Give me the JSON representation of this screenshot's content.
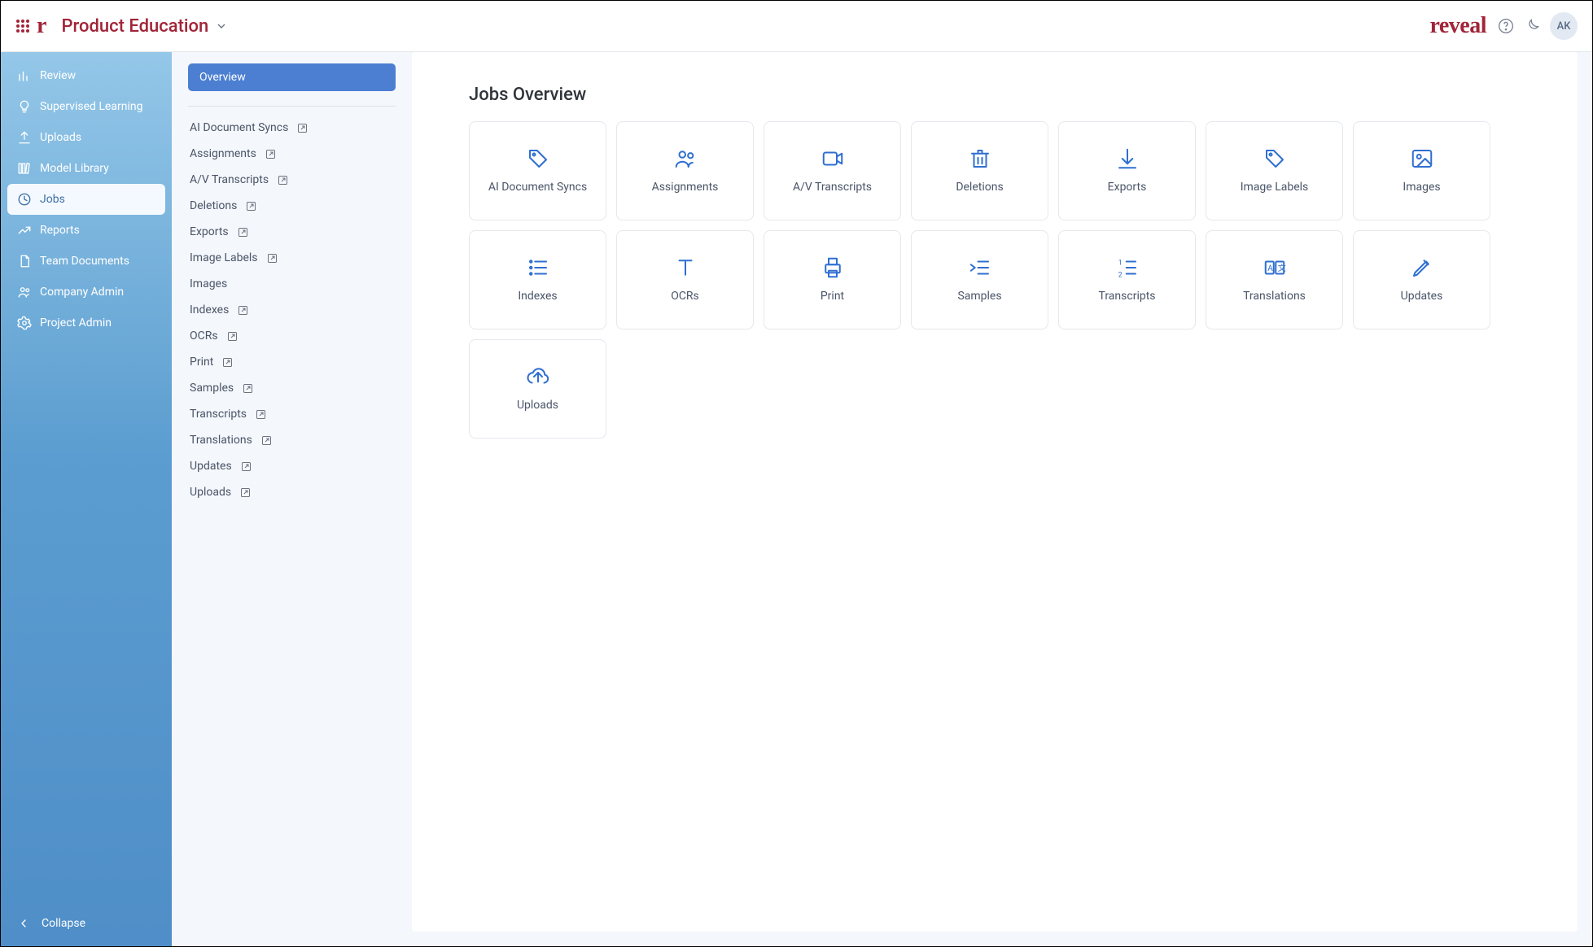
{
  "header": {
    "project_name": "Product Education",
    "brand_logo": "reveal",
    "avatar_initials": "AK"
  },
  "nav1": {
    "items": [
      {
        "label": "Review",
        "icon": "bar-chart"
      },
      {
        "label": "Supervised Learning",
        "icon": "lightbulb"
      },
      {
        "label": "Uploads",
        "icon": "upload"
      },
      {
        "label": "Model Library",
        "icon": "library"
      },
      {
        "label": "Jobs",
        "icon": "clock",
        "active": true
      },
      {
        "label": "Reports",
        "icon": "line-chart"
      },
      {
        "label": "Team Documents",
        "icon": "document"
      },
      {
        "label": "Company Admin",
        "icon": "users"
      },
      {
        "label": "Project Admin",
        "icon": "gear"
      }
    ],
    "collapse_label": "Collapse"
  },
  "nav2": {
    "overview_label": "Overview",
    "items": [
      {
        "label": "AI Document Syncs",
        "external": true
      },
      {
        "label": "Assignments",
        "external": true
      },
      {
        "label": "A/V Transcripts",
        "external": true
      },
      {
        "label": "Deletions",
        "external": true
      },
      {
        "label": "Exports",
        "external": true
      },
      {
        "label": "Image Labels",
        "external": true
      },
      {
        "label": "Images",
        "external": false
      },
      {
        "label": "Indexes",
        "external": true
      },
      {
        "label": "OCRs",
        "external": true
      },
      {
        "label": "Print",
        "external": true
      },
      {
        "label": "Samples",
        "external": true
      },
      {
        "label": "Transcripts",
        "external": true
      },
      {
        "label": "Translations",
        "external": true
      },
      {
        "label": "Updates",
        "external": true
      },
      {
        "label": "Uploads",
        "external": true
      }
    ]
  },
  "content": {
    "title": "Jobs Overview",
    "cards": [
      {
        "label": "AI Document Syncs",
        "icon": "tag"
      },
      {
        "label": "Assignments",
        "icon": "users"
      },
      {
        "label": "A/V Transcripts",
        "icon": "video"
      },
      {
        "label": "Deletions",
        "icon": "trash"
      },
      {
        "label": "Exports",
        "icon": "download"
      },
      {
        "label": "Image Labels",
        "icon": "tag"
      },
      {
        "label": "Images",
        "icon": "image"
      },
      {
        "label": "Indexes",
        "icon": "list"
      },
      {
        "label": "OCRs",
        "icon": "text-t"
      },
      {
        "label": "Print",
        "icon": "printer"
      },
      {
        "label": "Samples",
        "icon": "indent"
      },
      {
        "label": "Transcripts",
        "icon": "numbered-list"
      },
      {
        "label": "Translations",
        "icon": "translate"
      },
      {
        "label": "Updates",
        "icon": "pencil"
      },
      {
        "label": "Uploads",
        "icon": "upload-cloud"
      }
    ]
  }
}
